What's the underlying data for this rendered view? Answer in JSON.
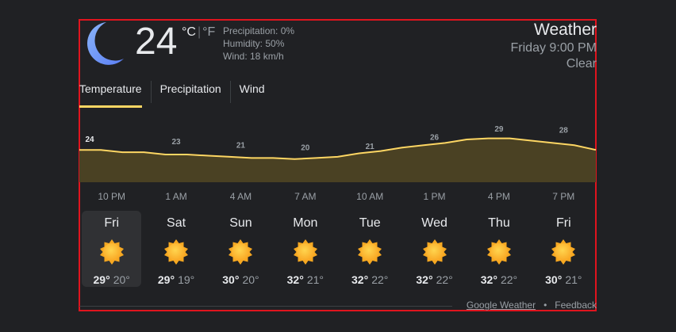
{
  "current": {
    "temp": "24",
    "unit_c": "°C",
    "unit_sep": "|",
    "unit_f": "°F",
    "precipitation": "Precipitation: 0%",
    "humidity": "Humidity: 50%",
    "wind": "Wind: 18 km/h",
    "icon": "moon-icon"
  },
  "header": {
    "title": "Weather",
    "time": "Friday 9:00 PM",
    "condition": "Clear"
  },
  "tabs": [
    {
      "label": "Temperature",
      "active": true
    },
    {
      "label": "Precipitation",
      "active": false
    },
    {
      "label": "Wind",
      "active": false
    }
  ],
  "chart_data": {
    "type": "area",
    "labels": [
      "24",
      "23",
      "21",
      "20",
      "21",
      "26",
      "29",
      "28"
    ],
    "hours": [
      "10 PM",
      "1 AM",
      "4 AM",
      "7 AM",
      "10 AM",
      "1 PM",
      "4 PM",
      "7 PM"
    ],
    "x": [
      0,
      1,
      2,
      3,
      4,
      5,
      6,
      7,
      8,
      9,
      10,
      11,
      12,
      13,
      14,
      15,
      16,
      17,
      18,
      19,
      20,
      21,
      22,
      23,
      24
    ],
    "values": [
      24,
      24,
      23,
      23,
      22,
      22,
      21.5,
      21,
      20.5,
      20.5,
      20,
      20.5,
      21,
      22.5,
      23.5,
      25,
      26,
      27,
      28.5,
      29,
      29,
      28,
      27,
      26,
      24
    ],
    "label_indices": [
      0,
      3,
      6,
      9,
      12,
      15,
      18,
      21
    ],
    "ylim": [
      10,
      34
    ],
    "colors": {
      "line": "#fdd663",
      "fill": "#4a4123"
    }
  },
  "days": [
    {
      "name": "Fri",
      "high": "29°",
      "low": "20°",
      "icon": "sun-icon",
      "selected": true
    },
    {
      "name": "Sat",
      "high": "29°",
      "low": "19°",
      "icon": "sun-icon",
      "selected": false
    },
    {
      "name": "Sun",
      "high": "30°",
      "low": "20°",
      "icon": "sun-icon",
      "selected": false
    },
    {
      "name": "Mon",
      "high": "32°",
      "low": "21°",
      "icon": "sun-icon",
      "selected": false
    },
    {
      "name": "Tue",
      "high": "32°",
      "low": "22°",
      "icon": "sun-icon",
      "selected": false
    },
    {
      "name": "Wed",
      "high": "32°",
      "low": "22°",
      "icon": "sun-icon",
      "selected": false
    },
    {
      "name": "Thu",
      "high": "32°",
      "low": "22°",
      "icon": "sun-icon",
      "selected": false
    },
    {
      "name": "Fri",
      "high": "30°",
      "low": "21°",
      "icon": "sun-icon",
      "selected": false
    }
  ],
  "footer": {
    "source": "Google Weather",
    "separator": "•",
    "feedback": "Feedback"
  },
  "colors": {
    "accent": "#fdd663",
    "frame": "#e0141e",
    "background": "#202124"
  }
}
